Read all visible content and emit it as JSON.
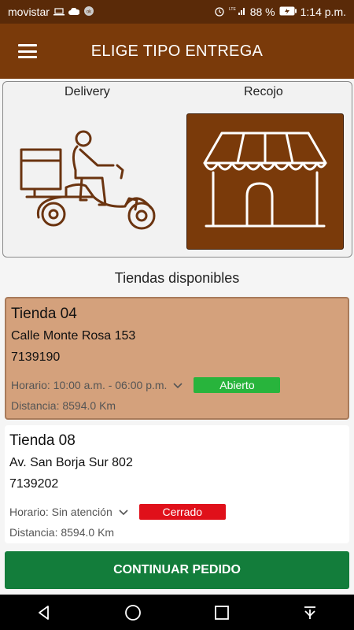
{
  "status_bar": {
    "carrier": "movistar",
    "battery": "88 %",
    "time": "1:14 p.m."
  },
  "app_bar": {
    "title": "ELIGE TIPO ENTREGA",
    "menu_icon": "hamburger-menu-icon"
  },
  "delivery_options": {
    "delivery_label": "Delivery",
    "recojo_label": "Recojo",
    "selected": "Recojo"
  },
  "stores_section": {
    "title": "Tiendas disponibles"
  },
  "stores": [
    {
      "name": "Tienda 04",
      "address": "Calle Monte Rosa 153",
      "phone": "7139190",
      "hours": "Horario: 10:00 a.m. - 06:00 p.m.",
      "status": "Abierto",
      "status_color": "#28b43c",
      "distance": "Distancia: 8594.0 Km",
      "selected": true
    },
    {
      "name": "Tienda 08",
      "address": "Av. San Borja Sur 802",
      "phone": "7139202",
      "hours": "Horario: Sin atención",
      "status": "Cerrado",
      "status_color": "#e0101a",
      "distance": "Distancia: 8594.0 Km",
      "selected": false
    }
  ],
  "cta": {
    "label": "CONTINUAR PEDIDO",
    "color": "#137d3b"
  },
  "colors": {
    "brand": "#7a3a0a",
    "status_bar": "#5a2a08"
  }
}
